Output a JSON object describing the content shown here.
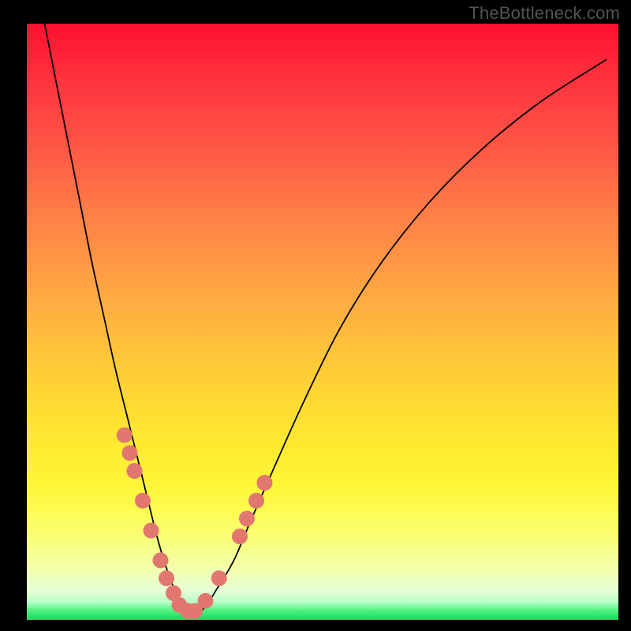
{
  "watermark": "TheBottleneck.com",
  "colors": {
    "dot": "#e2776f",
    "curve": "#000000",
    "frame": "#000000"
  },
  "chart_data": {
    "type": "line",
    "title": "",
    "xlabel": "",
    "ylabel": "",
    "xlim": [
      0,
      100
    ],
    "ylim": [
      0,
      100
    ],
    "grid": false,
    "legend": false,
    "series": [
      {
        "name": "bottleneck-curve",
        "x": [
          3,
          5,
          7,
          9,
          11,
          13,
          15,
          17,
          19,
          20.5,
          22,
          23.5,
          25,
          26.5,
          28,
          30,
          32,
          35,
          38,
          42,
          47,
          53,
          60,
          68,
          77,
          87,
          98
        ],
        "y": [
          100,
          90,
          80,
          70,
          60,
          51,
          42,
          34,
          26,
          20,
          14,
          9,
          5,
          2.5,
          1,
          2,
          5,
          10,
          17,
          26,
          37,
          49,
          60,
          70,
          79,
          87,
          94
        ]
      }
    ],
    "points": [
      {
        "name": "left-cluster-1",
        "x": 16.5,
        "y": 31
      },
      {
        "name": "left-cluster-2",
        "x": 17.4,
        "y": 28
      },
      {
        "name": "left-cluster-3",
        "x": 18.2,
        "y": 25
      },
      {
        "name": "left-cluster-4",
        "x": 19.6,
        "y": 20
      },
      {
        "name": "left-cluster-5",
        "x": 21.0,
        "y": 15
      },
      {
        "name": "left-cluster-6",
        "x": 22.6,
        "y": 10
      },
      {
        "name": "left-cluster-7",
        "x": 23.6,
        "y": 7
      },
      {
        "name": "left-cluster-8",
        "x": 24.8,
        "y": 4.5
      },
      {
        "name": "minimum-1",
        "x": 25.8,
        "y": 2.5
      },
      {
        "name": "minimum-2",
        "x": 27.2,
        "y": 1.5
      },
      {
        "name": "minimum-3",
        "x": 28.4,
        "y": 1.5
      },
      {
        "name": "right-cluster-1",
        "x": 30.2,
        "y": 3.2
      },
      {
        "name": "right-cluster-2",
        "x": 32.5,
        "y": 7
      },
      {
        "name": "right-cluster-3",
        "x": 36.0,
        "y": 14
      },
      {
        "name": "right-cluster-4",
        "x": 37.2,
        "y": 17
      },
      {
        "name": "right-cluster-5",
        "x": 38.8,
        "y": 20
      },
      {
        "name": "right-cluster-6",
        "x": 40.2,
        "y": 23
      }
    ]
  }
}
